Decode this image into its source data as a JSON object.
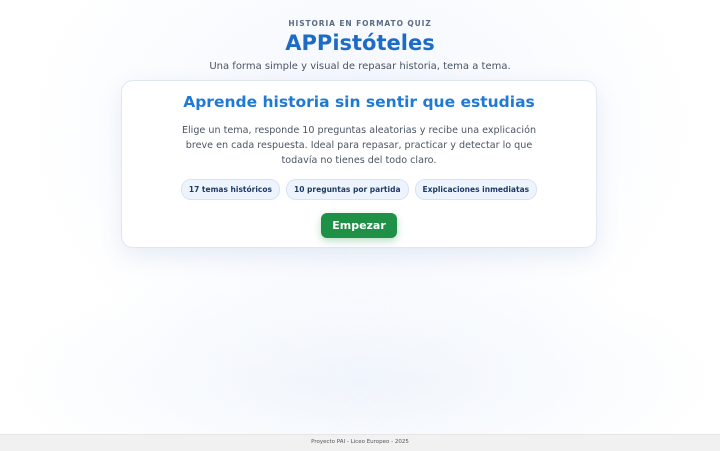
{
  "header": {
    "eyebrow": "HISTORIA EN FORMATO QUIZ",
    "title": "APPistóteles",
    "tagline": "Una forma simple y visual de repasar historia, tema a tema."
  },
  "card": {
    "title": "Aprende historia sin sentir que estudias",
    "description": "Elige un tema, responde 10 preguntas aleatorias y recibe una explicación breve en cada respuesta. Ideal para repasar, practicar y detectar lo que todavía no tienes del todo claro.",
    "chips": [
      "17 temas históricos",
      "10 preguntas por partida",
      "Explicaciones inmediatas"
    ],
    "start_label": "Empezar"
  },
  "footer": {
    "text": "Proyecto PAI - Liceo Europeo - 2025"
  },
  "colors": {
    "brand": "#1c6bc7",
    "card_title": "#1f7ad6",
    "start_button": "#1e9146"
  }
}
